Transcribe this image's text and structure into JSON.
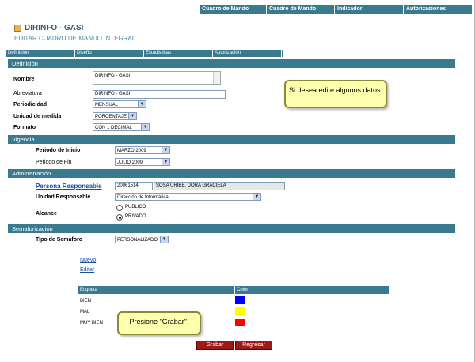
{
  "topnav": [
    "Cuadro de Mando Integral",
    "Cuadro de Mando",
    "Indicador",
    "Autorizaciones"
  ],
  "header": {
    "title": "DIRINFO - GASI",
    "subtitle": "EDITAR CUADRO DE MANDO INTEGRAL"
  },
  "tabs": [
    "Definición",
    "Diseño",
    "Estadisticas",
    "Autorización"
  ],
  "definicion": {
    "section": "Definición",
    "nombre_label": "Nombre",
    "nombre_value": "DIRINFO - GASI",
    "abreviatura_label": "Abreviatura",
    "abreviatura_value": "DIRINFO - GASI",
    "periodicidad_label": "Periodicidad",
    "periodicidad_value": "MENSUAL",
    "unidad_label": "Unidad de medida",
    "unidad_value": "PORCENTAJE",
    "formato_label": "Formato",
    "formato_value": "CON 1 DECIMAL"
  },
  "vigencia": {
    "section": "Vigencia",
    "inicio_label": "Periodo de Inicio",
    "inicio_value": "MARZO 2009",
    "fin_label": "Periodo de Fin",
    "fin_value": "JULIO 2009"
  },
  "administracion": {
    "section": "Administración",
    "responsable_label": "Persona Responsable",
    "responsable_code": "20061514",
    "responsable_name": "SOSA URIBE, DORA GRACIELA",
    "unidad_label": "Unidad Responsable",
    "unidad_value": "Dirección de Informática",
    "alcance_label": "Alcance",
    "opt_publico": "PUBLICO",
    "opt_privado": "PRIVADO",
    "alcance_selected": "PRIVADO"
  },
  "semaforizacion": {
    "section": "Semaforización",
    "tipo_label": "Tipo de Semáforo",
    "tipo_value": "PERSONALIZADO",
    "nuevo": "Nuevo",
    "editar": "Editar",
    "col_etiqueta": "Etiqueta",
    "col_color": "Color",
    "rows": [
      {
        "etiqueta": "BIEN",
        "color": "#0000ff"
      },
      {
        "etiqueta": "MAL",
        "color": "#ffff00"
      },
      {
        "etiqueta": "MUY BIEN",
        "color": "#ff0000"
      }
    ]
  },
  "notes": {
    "edit_hint": "Si desea edite algunos datos.",
    "save_hint": "Presione \"Grabar\"."
  },
  "buttons": {
    "grabar": "Grabar",
    "regresar": "Regresar"
  },
  "colors": {
    "header_bar": "#3a7a8f",
    "button": "#a01818",
    "note_bg": "#ffffb0"
  }
}
